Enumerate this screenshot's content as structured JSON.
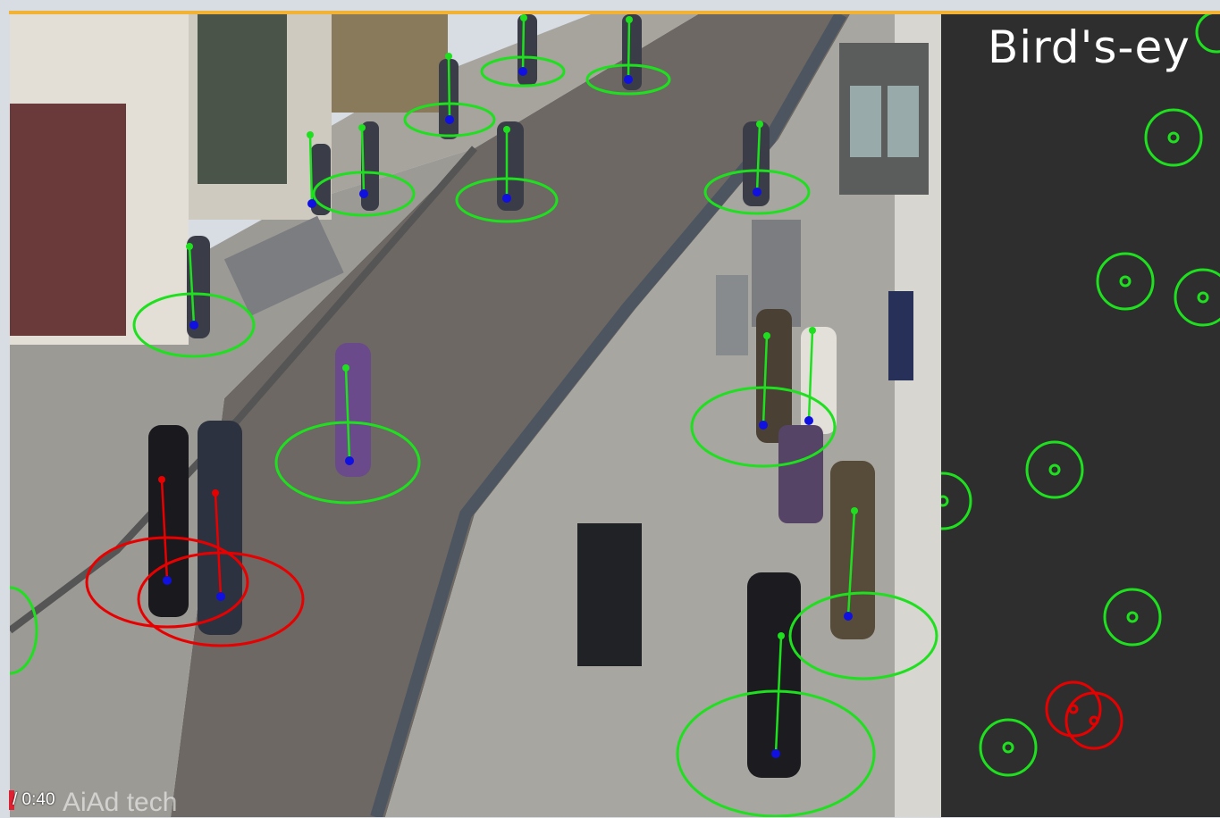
{
  "colors": {
    "accent_bar": "#f2b233",
    "safe": "#1ee01e",
    "violation": "#e80000",
    "foot_point": "#1010e0",
    "panel_bg": "#2e2e2e"
  },
  "video": {
    "time_display": "/ 0:40",
    "watermark": "AiAd tech"
  },
  "birdseye": {
    "title": "Bird's-ey"
  },
  "legend_semantics": {
    "safe_marker": "green circle",
    "violation_marker": "red circle"
  }
}
